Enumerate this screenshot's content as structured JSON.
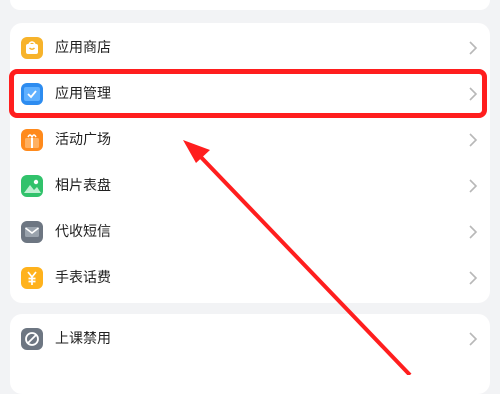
{
  "groups": [
    {
      "items": [
        {
          "label": "应用商店",
          "icon": "store-bag-icon",
          "color": "#f7b32b"
        },
        {
          "label": "应用管理",
          "icon": "app-management-icon",
          "color": "#2d8cf0"
        },
        {
          "label": "活动广场",
          "icon": "gift-icon",
          "color": "#ff8a1c"
        },
        {
          "label": "相片表盘",
          "icon": "photo-watchface-icon",
          "color": "#31c26b"
        },
        {
          "label": "代收短信",
          "icon": "sms-envelope-icon",
          "color": "#6d7682"
        },
        {
          "label": "手表话费",
          "icon": "yuan-bill-icon",
          "color": "#ffb21c"
        }
      ]
    },
    {
      "items": [
        {
          "label": "上课禁用",
          "icon": "class-disable-icon",
          "color": "#6d7682"
        }
      ]
    }
  ],
  "annotation": {
    "highlight_color": "#ff1e1e"
  }
}
